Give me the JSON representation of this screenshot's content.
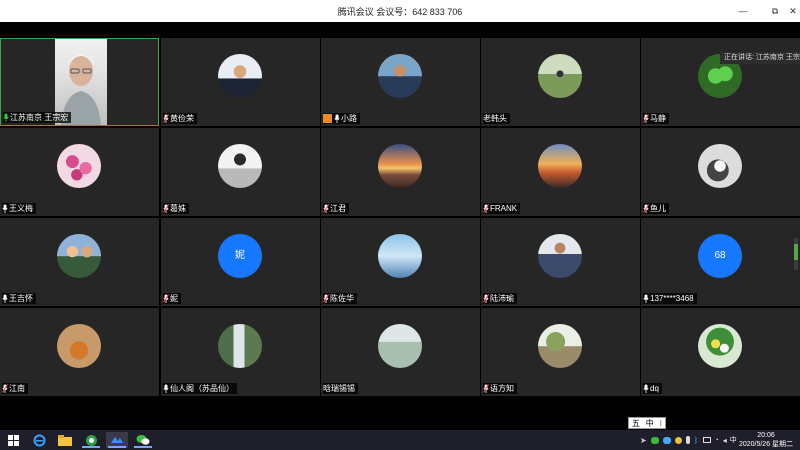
{
  "window": {
    "title": "腾讯会议 会议号：642 833 706",
    "min_label": "—",
    "max_label": "⧉",
    "close_label": "✕"
  },
  "speaking_now": "正在讲话: 江苏南京 王宗宏",
  "participants": [
    {
      "name": "江苏南京 王宗宏",
      "avatar": "video",
      "mic": "green",
      "active": true
    },
    {
      "name": "黄俭荣",
      "avatar": "photo-man-suit",
      "mic": "muted"
    },
    {
      "name": "小路",
      "avatar": "photo-man-outdoor",
      "mic": "white",
      "badge": "orange-pic"
    },
    {
      "name": "老韩头",
      "avatar": "photo-man-park",
      "mic": "none"
    },
    {
      "name": "马静",
      "avatar": "photo-clover",
      "mic": "muted"
    },
    {
      "name": "王义梅",
      "avatar": "photo-radishes",
      "mic": "white"
    },
    {
      "name": "葛姝",
      "avatar": "photo-woman",
      "mic": "muted"
    },
    {
      "name": "江君",
      "avatar": "photo-sunset",
      "mic": "muted"
    },
    {
      "name": "FRANK",
      "avatar": "photo-city",
      "mic": "muted"
    },
    {
      "name": "鱼儿",
      "avatar": "photo-lotus",
      "mic": "muted"
    },
    {
      "name": "王吉怀",
      "avatar": "photo-couple",
      "mic": "white"
    },
    {
      "name": "妮",
      "avatar": "text",
      "avatar_text": "妮",
      "mic": "muted"
    },
    {
      "name": "陈佐华",
      "avatar": "photo-sky",
      "mic": "muted"
    },
    {
      "name": "陆沛瑜",
      "avatar": "photo-man-plaid",
      "mic": "muted"
    },
    {
      "name": "137****3468",
      "avatar": "text",
      "avatar_text": "68",
      "mic": "white"
    },
    {
      "name": "江南",
      "avatar": "photo-tiger-art",
      "mic": "muted"
    },
    {
      "name": "仙人阁（苏品仙）",
      "avatar": "photo-waterfall",
      "mic": "white"
    },
    {
      "name": "晗瑞锡锡",
      "avatar": "photo-lake",
      "mic": "none"
    },
    {
      "name": "语方知",
      "avatar": "photo-trees",
      "mic": "muted"
    },
    {
      "name": "dq",
      "avatar": "photo-flowers",
      "mic": "white"
    }
  ],
  "ime": {
    "mode": "五",
    "lang": "中"
  },
  "taskbar": {
    "apps": [
      "windows-start-icon",
      "ie-icon",
      "file-explorer-icon",
      "360-browser-icon",
      "tencent-meeting-icon",
      "wechat-icon"
    ],
    "clock_time": "20:06",
    "clock_date": "2020/5/26 星期二"
  },
  "colors": {
    "tile": "#262626",
    "active_border": "#3fa34d",
    "avatar_blue": "#1677ff",
    "mic_green": "#2ecc40"
  }
}
